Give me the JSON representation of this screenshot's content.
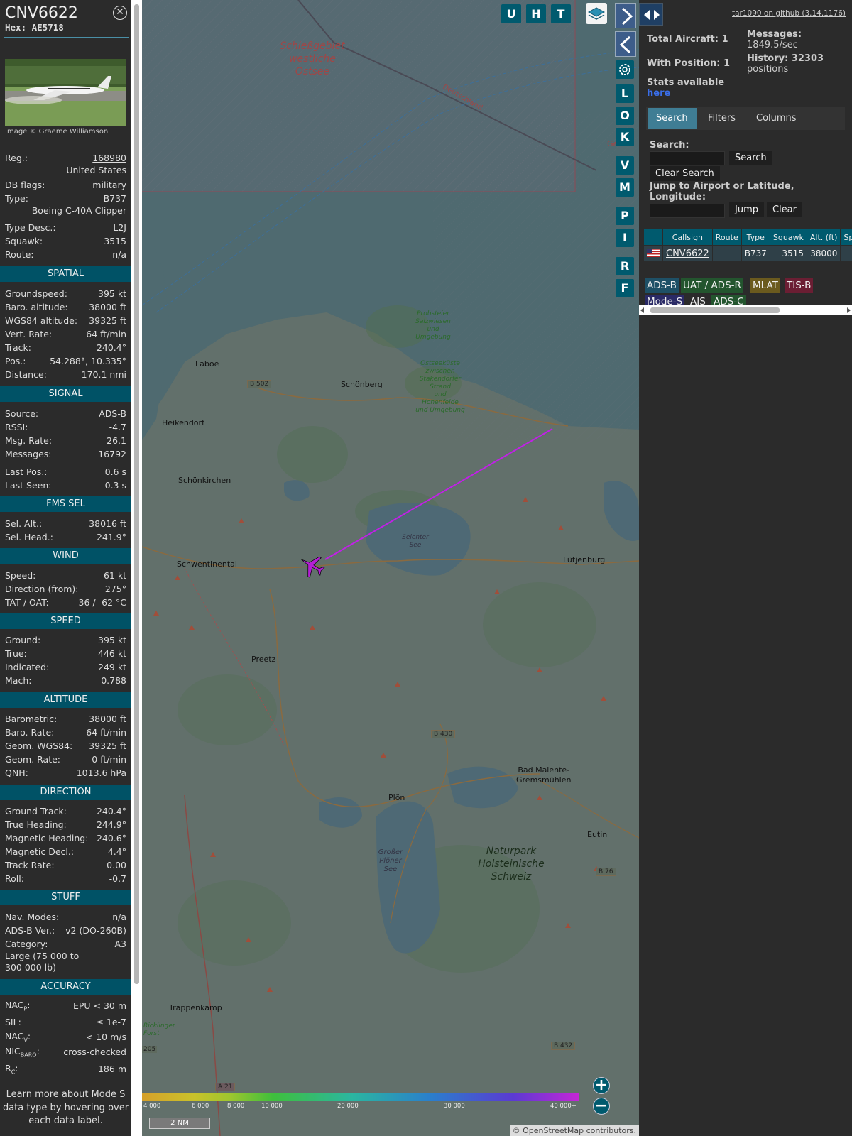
{
  "sidebar": {
    "callsign": "CNV6622",
    "hex": "Hex: AE5718",
    "photo_credit": "Image © Graeme Williamson",
    "reg_label": "Reg.:",
    "reg": "168980",
    "country": "United States",
    "dbflags_label": "DB flags:",
    "dbflags": "military",
    "type_label": "Type:",
    "type": "B737",
    "type_full": "Boeing C-40A Clipper",
    "typedesc_label": "Type Desc.:",
    "typedesc": "L2J",
    "squawk_label": "Squawk:",
    "squawk": "3515",
    "route_label": "Route:",
    "route": "n/a",
    "sections": {
      "spatial": "SPATIAL",
      "signal": "SIGNAL",
      "fms": "FMS SEL",
      "wind": "WIND",
      "speed": "SPEED",
      "altitude": "ALTITUDE",
      "direction": "DIRECTION",
      "stuff": "STUFF",
      "accuracy": "ACCURACY"
    },
    "spatial": [
      [
        "Groundspeed:",
        "395 kt"
      ],
      [
        "Baro. altitude:",
        "38000 ft"
      ],
      [
        "WGS84 altitude:",
        "39325 ft"
      ],
      [
        "Vert. Rate:",
        "64 ft/min"
      ],
      [
        "Track:",
        "240.4°"
      ],
      [
        "Pos.:",
        "54.288°, 10.335°"
      ],
      [
        "Distance:",
        "170.1 nmi"
      ]
    ],
    "signal": [
      [
        "Source:",
        "ADS-B"
      ],
      [
        "RSSI:",
        "-4.7"
      ],
      [
        "Msg. Rate:",
        "26.1"
      ],
      [
        "Messages:",
        "16792"
      ],
      [
        "Last Pos.:",
        "0.6 s"
      ],
      [
        "Last Seen:",
        "0.3 s"
      ]
    ],
    "fms": [
      [
        "Sel. Alt.:",
        "38016 ft"
      ],
      [
        "Sel. Head.:",
        "241.9°"
      ]
    ],
    "wind": [
      [
        "Speed:",
        "61 kt"
      ],
      [
        "Direction (from):",
        "275°"
      ],
      [
        "TAT / OAT:",
        "-36 / -62 °C"
      ]
    ],
    "speed": [
      [
        "Ground:",
        "395 kt"
      ],
      [
        "True:",
        "446 kt"
      ],
      [
        "Indicated:",
        "249 kt"
      ],
      [
        "Mach:",
        "0.788"
      ]
    ],
    "altitude": [
      [
        "Barometric:",
        "38000 ft"
      ],
      [
        "Baro. Rate:",
        "64 ft/min"
      ],
      [
        "Geom. WGS84:",
        "39325 ft"
      ],
      [
        "Geom. Rate:",
        "0 ft/min"
      ],
      [
        "QNH:",
        "1013.6 hPa"
      ]
    ],
    "direction": [
      [
        "Ground Track:",
        "240.4°"
      ],
      [
        "True Heading:",
        "244.9°"
      ],
      [
        "Magnetic Heading:",
        "240.6°"
      ],
      [
        "Magnetic Decl.:",
        "4.4°"
      ],
      [
        "Track Rate:",
        "0.00"
      ],
      [
        "Roll:",
        "-0.7"
      ]
    ],
    "stuff": [
      [
        "Nav. Modes:",
        "n/a"
      ],
      [
        "ADS-B Ver.:",
        "v2 (DO-260B)"
      ],
      [
        "Category:",
        "A3"
      ]
    ],
    "category_desc": "Large (75 000 to 300 000 lb)",
    "accuracy": {
      "nacp_k": "NAC",
      "nacp_sub": "P",
      "nacp_v": "EPU < 30 m",
      "sil_k": "SIL:",
      "sil_v": "≤ 1e-7",
      "nacv_k": "NAC",
      "nacv_sub": "V",
      "nacv_v": "< 10 m/s",
      "nicb_k": "NIC",
      "nicb_sub": "BARO",
      "nicb_v": "cross-checked",
      "rc_k": "R",
      "rc_sub": "C",
      "rc_v": "186 m"
    },
    "note": "Learn more about Mode S data type by hovering over each data label."
  },
  "map": {
    "buttons": {
      "u": "U",
      "h": "H",
      "t": "T",
      "l": "L",
      "o": "O",
      "k": "K",
      "v": "V",
      "m": "M",
      "p": "P",
      "i": "I",
      "r": "R",
      "f": "F"
    },
    "labels": {
      "schiess": "Schießgebiet",
      "westliche": "westliche",
      "ostsee": "Ostsee",
      "deutschland": "Deutschland",
      "ge": "Ge",
      "laboe": "Laboe",
      "schoenberg": "Schönberg",
      "heikendorf": "Heikendorf",
      "schoenkirchen": "Schönkirchen",
      "schwentinental": "Schwentinental",
      "preetz": "Preetz",
      "luetjenburg": "Lütjenburg",
      "plon": "Plön",
      "eutin": "Eutin",
      "malente1": "Bad Malente-",
      "malente2": "Gremsmühlen",
      "trappenkamp": "Trappenkamp",
      "naturpark1": "Naturpark",
      "naturpark2": "Holsteinische",
      "naturpark3": "Schweiz",
      "b502": "B 502",
      "b430": "B 430",
      "b432": "B 432",
      "b76": "B 76",
      "a21": "A 21",
      "b205": "205",
      "probsteier1": "Probsteier",
      "probsteier2": "Salzwiesen",
      "probsteier3": "und Umgebung",
      "ostsee1": "Ostseeküste",
      "ostsee2": "zwischen",
      "ostsee3": "Stakendorfer",
      "ostsee4": "Strand",
      "ostsee5": "und Hohenfelde",
      "ostsee6": "und Umgebung",
      "selenter1": "Selenter",
      "selenter2": "See",
      "plo1": "Großer",
      "plo2": "Plöner",
      "plo3": "See",
      "ricklinger1": "Ricklinger",
      "ricklinger2": "Forst"
    },
    "altitude_scale": [
      "4 000",
      "6 000",
      "8 000",
      "10 000",
      "20 000",
      "30 000",
      "40 000+"
    ],
    "distance_scale": "2 NM",
    "attribution": "© OpenStreetMap contributors.",
    "zoom_in": "+",
    "zoom_out": "−"
  },
  "panel": {
    "github": "tar1090 on github (3.14.1176)",
    "total_aircraft": "Total Aircraft: 1",
    "messages_label": "Messages:",
    "messages_rate": "1849.5/sec",
    "with_position": "With Position: 1",
    "history_label": "History: 32303",
    "history_unit": "positions",
    "stats_label": "Stats available",
    "stats_link": "here",
    "tabs": [
      "Search",
      "Filters",
      "Columns"
    ],
    "search_label": "Search:",
    "search_button": "Search",
    "clear_search": "Clear Search",
    "jump_label": "Jump to Airport or Latitude, Longitude:",
    "jump_button": "Jump",
    "clear_button": "Clear",
    "table_headers": [
      "",
      "Callsign",
      "Route",
      "Type",
      "Squawk",
      "Alt. (ft)",
      "Sp"
    ],
    "table_row": {
      "callsign": "CNV6622",
      "route": "",
      "type": "B737",
      "squawk": "3515",
      "alt": "38000"
    },
    "badges": [
      "ADS-B",
      "UAT / ADS-R",
      "MLAT",
      "TIS-B",
      "Mode-S",
      "AIS",
      "ADS-C"
    ]
  }
}
